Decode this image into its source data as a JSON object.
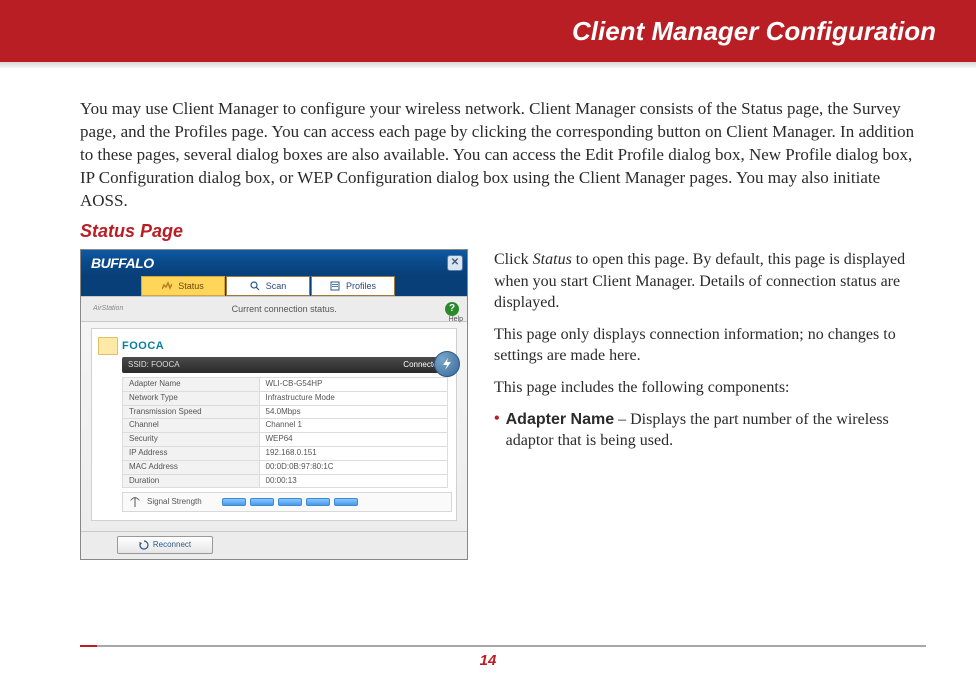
{
  "page": {
    "header_title": "Client Manager Configuration",
    "intro": "You may use Client Manager to configure your wireless network. Client Manager consists of the Status page, the Survey page, and the Profiles page. You can access each page by clicking the corresponding button on Client Manager. In addition to these pages, several dialog boxes are also available. You can access the Edit Profile dialog box, New Profile dialog box, IP Configuration dialog box, or WEP Configuration dialog box using the Client Manager pages.  You may also initiate AOSS.",
    "section_title": "Status Page",
    "page_number": "14"
  },
  "right": {
    "p1_a": "Click ",
    "p1_em": "Status",
    "p1_b": " to open this page. By default, this page is displayed when you start Client Manager. Details of connection status are displayed.",
    "p2": "This page only displays connection information; no changes to settings are made here.",
    "p3": "This page includes the following components:",
    "bullet_label": "Adapter Name",
    "bullet_text": " – Displays the part number of the wireless adaptor that is being used."
  },
  "app": {
    "brand": "BUFFALO",
    "sub_brand": "AirStation",
    "tabs": {
      "status": "Status",
      "scan": "Scan",
      "profiles": "Profiles"
    },
    "subbar_text": "Current connection status.",
    "help_label": "Help",
    "ssid_name": "FOOCA",
    "ssid_prefix": "SSID: FOOCA",
    "connected": "Connected",
    "details": [
      {
        "k": "Adapter Name",
        "v": "WLI-CB-G54HP"
      },
      {
        "k": "Network Type",
        "v": "Infrastructure Mode"
      },
      {
        "k": "Transmission Speed",
        "v": "54.0Mbps"
      },
      {
        "k": "Channel",
        "v": "Channel 1"
      },
      {
        "k": "Security",
        "v": "WEP64"
      },
      {
        "k": "IP Address",
        "v": "192.168.0.151"
      },
      {
        "k": "MAC Address",
        "v": "00:0D:0B:97:80:1C"
      },
      {
        "k": "Duration",
        "v": "00:00:13"
      }
    ],
    "signal_label": "Signal Strength",
    "reconnect": "Reconnect"
  }
}
